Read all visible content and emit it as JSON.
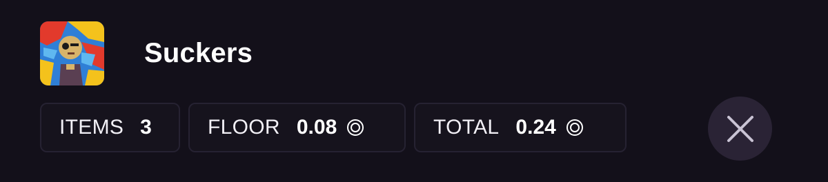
{
  "collection": {
    "name": "Suckers",
    "thumbnail_icon": "collection-thumbnail"
  },
  "stats": {
    "items_label": "ITEMS",
    "items_value": "3",
    "floor_label": "FLOOR",
    "floor_value": "0.08",
    "total_label": "TOTAL",
    "total_value": "0.24",
    "currency_icon": "coin-icon"
  },
  "close": {
    "icon": "close-icon"
  },
  "colors": {
    "background": "#13101a",
    "stat_border": "#262232",
    "close_button_bg": "#2a2335",
    "close_icon": "#c9c3d4"
  }
}
